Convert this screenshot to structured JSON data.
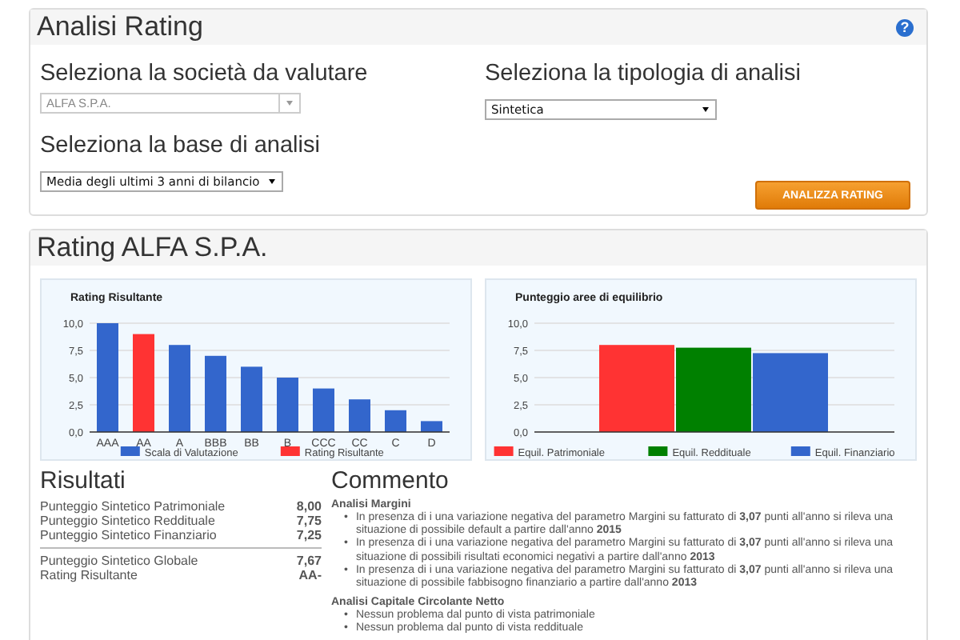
{
  "panel": {
    "title": "Analisi Rating",
    "help": "?",
    "fields": [
      {
        "kind": "combo",
        "label": "Seleziona la società da valutare",
        "value": "ALFA S.P.A."
      },
      {
        "kind": "select",
        "label": "Seleziona la tipologia di analisi",
        "value": "Sintetica"
      },
      {
        "kind": "select",
        "label": "Seleziona la base di analisi",
        "value": "Media degli ultimi 3 anni di bilancio"
      }
    ],
    "button": "ANALIZZA RATING"
  },
  "rating": {
    "title": "Rating ALFA S.P.A.",
    "charts": [
      {
        "chart_data": {
          "type": "bar",
          "title": "Rating Risultante",
          "categories": [
            "AAA",
            "AA",
            "A",
            "BBB",
            "BB",
            "B",
            "CCC",
            "CC",
            "C",
            "D"
          ],
          "series": [
            {
              "name": "Scala di Valutazione",
              "color": "#3366cc",
              "values": [
                10,
                null,
                8,
                7,
                6,
                5,
                4,
                3,
                2,
                1
              ]
            },
            {
              "name": "Rating Risultante",
              "color": "#ff3333",
              "values": [
                null,
                9,
                null,
                null,
                null,
                null,
                null,
                null,
                null,
                null
              ]
            }
          ],
          "ylim": [
            0,
            10
          ],
          "grid": true,
          "legend": "bottom",
          "yticks": [
            {
              "value": 0,
              "label": "0,0"
            },
            {
              "value": 2.5,
              "label": "2,5"
            },
            {
              "value": 5,
              "label": "5,0"
            },
            {
              "value": 7.5,
              "label": "7,5"
            },
            {
              "value": 10,
              "label": "10,0"
            }
          ]
        }
      },
      {
        "chart_data": {
          "type": "bar",
          "title": "Punteggio aree di equilibrio",
          "series": [
            {
              "name": "Equil. Patrimoniale",
              "color": "#ff3333",
              "values": [
                8
              ]
            },
            {
              "name": "Equil. Reddituale",
              "color": "#008000",
              "values": [
                7.75
              ]
            },
            {
              "name": "Equil. Finanziario",
              "color": "#3366cc",
              "values": [
                7.25
              ]
            }
          ],
          "ylim": [
            0,
            10
          ],
          "grid": true,
          "legend": "bottom",
          "yticks": [
            {
              "value": 0,
              "label": "0,0"
            },
            {
              "value": 2.5,
              "label": "2,5"
            },
            {
              "value": 5,
              "label": "5,0"
            },
            {
              "value": 7.5,
              "label": "7,5"
            },
            {
              "value": 10,
              "label": "10,0"
            }
          ]
        }
      }
    ],
    "results": {
      "title": "Risultati",
      "groups": [
        {
          "rows": [
            {
              "label": "Punteggio Sintetico Patrimoniale",
              "value": "8,00"
            },
            {
              "label": "Punteggio Sintetico Reddituale",
              "value": "7,75"
            },
            {
              "label": "Punteggio Sintetico Finanziario",
              "value": "7,25"
            }
          ]
        },
        {
          "rows": [
            {
              "label": "Punteggio Sintetico Globale",
              "value": "7,67"
            },
            {
              "label": "Rating Risultante",
              "value": "AA-"
            }
          ]
        }
      ]
    },
    "comment": {
      "title": "Commento",
      "sections": [
        {
          "title": "Analisi Margini",
          "items": [
            {
              "marker": "•",
              "text": "In presenza di i una variazione negativa del parametro Margini su fatturato di **3,07** punti all'anno si rileva una situazione di possibile default a partire dall'anno **2015**"
            },
            {
              "marker": "•",
              "text": "In presenza di i una variazione negativa del parametro Margini su fatturato di **3,07** punti all'anno si rileva una situazione di possibili risultati economici negativi a partire dall'anno **2013**"
            },
            {
              "marker": "•",
              "text": "In presenza di i una variazione negativa del parametro Margini su fatturato di **3,07** punti all'anno si rileva una situazione di possibile fabbisogno finanziario a partire dall'anno **2013**"
            }
          ]
        },
        {
          "title": "Analisi Capitale Circolante Netto",
          "items": [
            {
              "marker": "•",
              "text": "Nessun problema dal punto di vista patrimoniale"
            },
            {
              "marker": "•",
              "text": "Nessun problema dal punto di vista reddituale"
            }
          ]
        }
      ]
    }
  }
}
